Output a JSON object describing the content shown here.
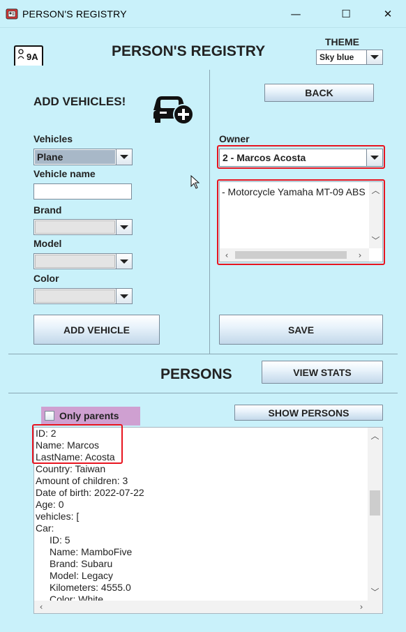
{
  "window": {
    "title": "PERSON'S REGISTRY",
    "minimize": "—",
    "maximize": "☐",
    "close": "✕"
  },
  "header": {
    "title": "PERSON'S REGISTRY",
    "theme_label": "THEME",
    "theme_value": "Sky blue",
    "logo_text": "9A"
  },
  "vehicles_panel": {
    "heading": "ADD VEHICLES!",
    "vehicles_label": "Vehicles",
    "vehicles_value": "Plane",
    "vehicle_name_label": "Vehicle name",
    "vehicle_name_value": "",
    "brand_label": "Brand",
    "model_label": "Model",
    "color_label": "Color",
    "add_button": "ADD VEHICLE"
  },
  "owner_panel": {
    "back_button": "BACK",
    "owner_label": "Owner",
    "owner_value": "2 - Marcos Acosta",
    "vehicle_list": [
      "- Motorcycle Yamaha MT-09 ABS"
    ],
    "save_button": "SAVE"
  },
  "persons_panel": {
    "heading": "PERSONS",
    "view_stats_button": "VIEW STATS",
    "only_parents_label": "Only parents",
    "show_persons_button": "SHOW PERSONS",
    "details_lines": [
      "ID: 2",
      "Name: Marcos",
      "LastName: Acosta",
      "Country: Taiwan",
      "Amount of children: 3",
      "Date of birth: 2022-07-22",
      "Age: 0",
      "vehicles: [",
      "Car:",
      "    ID: 5",
      "    Name: MamboFive",
      "    Brand: Subaru",
      "    Model: Legacy",
      "    Kilometers: 4555.0",
      "    Color: White"
    ]
  },
  "colors": {
    "background": "#c9f1fa",
    "highlight": "#e8141f",
    "checkbox_panel": "#cfa0d1",
    "selected_combo": "#a8b8c8"
  },
  "icons": {
    "app": "registry-app-icon",
    "car_add": "car-plus-icon",
    "logo": "id-card-icon"
  }
}
